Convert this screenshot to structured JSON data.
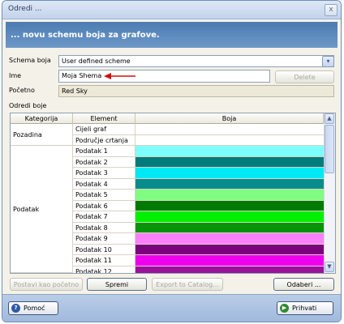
{
  "window": {
    "title": "Odredi ...",
    "close_glyph": "x"
  },
  "header": {
    "text": "... novu schemu boja za grafove."
  },
  "form": {
    "schema_label": "Schema boja",
    "schema_value": "User defined scheme",
    "name_label": "Ime",
    "name_value": "Moja Shema",
    "delete_label": "Delete",
    "start_label": "Početno",
    "start_value": "Red Sky",
    "section_label": "Odredi boje"
  },
  "grid": {
    "columns": [
      "Kategorija",
      "Element",
      "Boja"
    ],
    "categories": [
      "Pozadina",
      "Podatak"
    ],
    "rows": [
      {
        "element": "Cijeli graf",
        "color": "#ffffff"
      },
      {
        "element": "Područje crtanja",
        "color": "#ffffff"
      },
      {
        "element": "Podatak 1",
        "color": "#7ffcfc"
      },
      {
        "element": "Podatak 2",
        "color": "#017b7b"
      },
      {
        "element": "Podatak 3",
        "color": "#00e8f4"
      },
      {
        "element": "Podatak 4",
        "color": "#078c8c"
      },
      {
        "element": "Podatak 5",
        "color": "#80fc80"
      },
      {
        "element": "Podatak 6",
        "color": "#037b03"
      },
      {
        "element": "Podatak 7",
        "color": "#01f001"
      },
      {
        "element": "Podatak 8",
        "color": "#089408"
      },
      {
        "element": "Podatak 9",
        "color": "#fc80fc"
      },
      {
        "element": "Podatak 10",
        "color": "#7b037b"
      },
      {
        "element": "Podatak 11",
        "color": "#ee00ee"
      },
      {
        "element": "Podatak 12",
        "color": "#9c109c"
      }
    ]
  },
  "actions": {
    "reset_label": "Postavi kao početno",
    "save_label": "Spremi",
    "export_label": "Export to Catalog...",
    "choose_label": "Odaberi ..."
  },
  "footer": {
    "help_label": "Pomoć",
    "help_icon_glyph": "?",
    "accept_label": "Prihvati",
    "accept_icon_glyph": "▶"
  },
  "colors": {
    "header_blue": "#5b89bd",
    "arrow_red": "#d01010"
  }
}
